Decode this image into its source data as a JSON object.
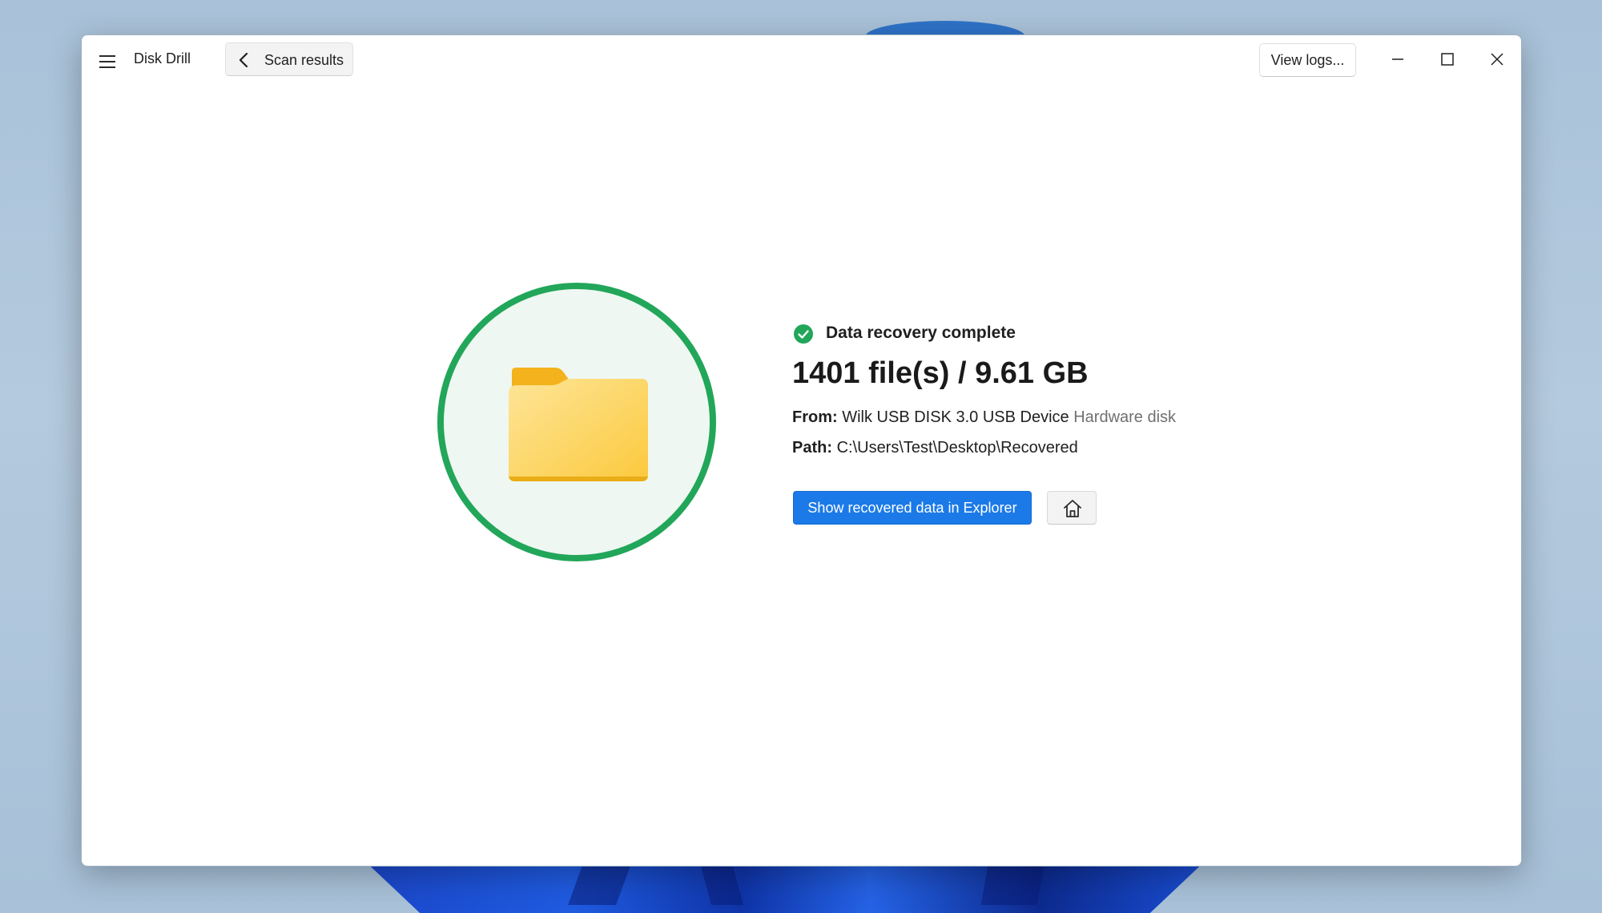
{
  "app": {
    "title": "Disk Drill"
  },
  "navigation": {
    "back_label": "Scan results"
  },
  "toolbar": {
    "view_logs_label": "View logs..."
  },
  "result": {
    "status": "Data recovery complete",
    "summary": "1401 file(s) / 9.61 GB",
    "from_label": "From:",
    "from_device": "Wilk USB DISK 3.0 USB Device",
    "from_type": "Hardware disk",
    "path_label": "Path:",
    "path_value": "C:\\Users\\Test\\Desktop\\Recovered"
  },
  "actions": {
    "show_in_explorer_label": "Show recovered data in Explorer"
  },
  "icons": {
    "menu": "hamburger-menu-icon",
    "back": "chevron-left-icon",
    "minimize": "minimize-icon",
    "maximize": "maximize-icon",
    "close": "close-icon",
    "status": "check-circle-icon",
    "folder": "folder-icon",
    "home": "home-icon"
  },
  "colors": {
    "success": "#22a65a",
    "success_fill": "#eff7f2",
    "primary": "#1b7ae8",
    "folder": "#fbc93a"
  }
}
